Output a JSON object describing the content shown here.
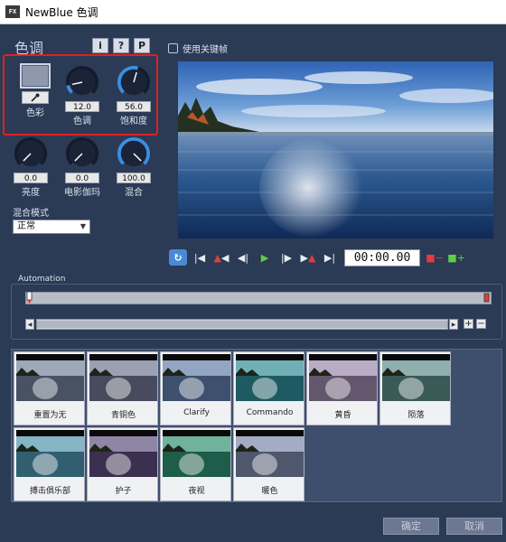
{
  "window": {
    "icon_text": "FX",
    "title": "NewBlue 色调"
  },
  "panel": {
    "title": "色调",
    "header_buttons": [
      "i",
      "?",
      "P"
    ]
  },
  "color_controls": {
    "color_label": "色彩",
    "knobs": [
      {
        "label": "色调",
        "value": "12.0",
        "level": 0.12
      },
      {
        "label": "饱和度",
        "value": "56.0",
        "level": 0.56
      },
      {
        "label": "亮度",
        "value": "0.0",
        "level": 0.0
      },
      {
        "label": "电影伽玛",
        "value": "0.0",
        "level": 0.0
      },
      {
        "label": "混合",
        "value": "100.0",
        "level": 1.0
      }
    ]
  },
  "blend": {
    "label": "混合模式",
    "selected": "正常"
  },
  "keyframes": {
    "label": "使用关键帧",
    "checked": false
  },
  "transport": {
    "timecode": "00:00.00"
  },
  "automation": {
    "label": "Automation"
  },
  "presets": [
    {
      "name": "重置为无",
      "tint": "#6f7f99"
    },
    {
      "name": "青铜色",
      "tint": "#6d7390"
    },
    {
      "name": "Clarify",
      "tint": "#5f7ca8"
    },
    {
      "name": "Commando",
      "tint": "#2f8a96"
    },
    {
      "name": "黄昏",
      "tint": "#9a86a8"
    },
    {
      "name": "陨落",
      "tint": "#5a8a88"
    },
    {
      "name": "搏击俱乐部",
      "tint": "#4d92ac"
    },
    {
      "name": "护子",
      "tint": "#5b4b7a"
    },
    {
      "name": "夜视",
      "tint": "#2e8f70"
    },
    {
      "name": "暖色",
      "tint": "#7a86a8"
    }
  ],
  "footer": {
    "ok_label": "确定",
    "cancel_label": "取消"
  },
  "colors": {
    "background": "#2b3a55",
    "knob_accent": "#3a8fe0",
    "highlight": "#e02020"
  }
}
